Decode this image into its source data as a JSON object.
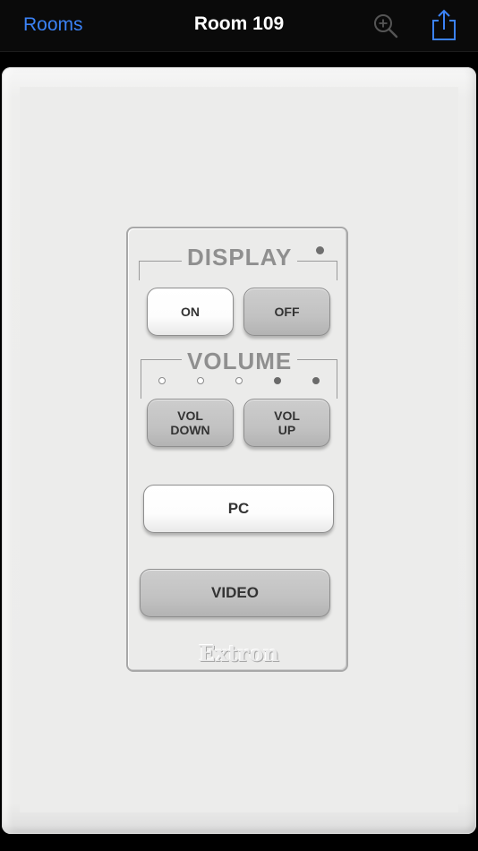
{
  "navbar": {
    "back_label": "Rooms",
    "title": "Room 109",
    "zoom_icon": "magnifier-plus-icon",
    "share_icon": "share-icon",
    "accent_color": "#3b82f6"
  },
  "keypad": {
    "display_section": {
      "label": "DISPLAY",
      "on_label": "ON",
      "off_label": "OFF"
    },
    "volume_section": {
      "label": "VOLUME",
      "levels": [
        "off",
        "off",
        "off",
        "on",
        "on"
      ],
      "down_label_line1": "VOL",
      "down_label_line2": "DOWN",
      "up_label_line1": "VOL",
      "up_label_line2": "UP"
    },
    "pc_label": "PC",
    "video_label": "VIDEO",
    "brand": "Extron"
  }
}
